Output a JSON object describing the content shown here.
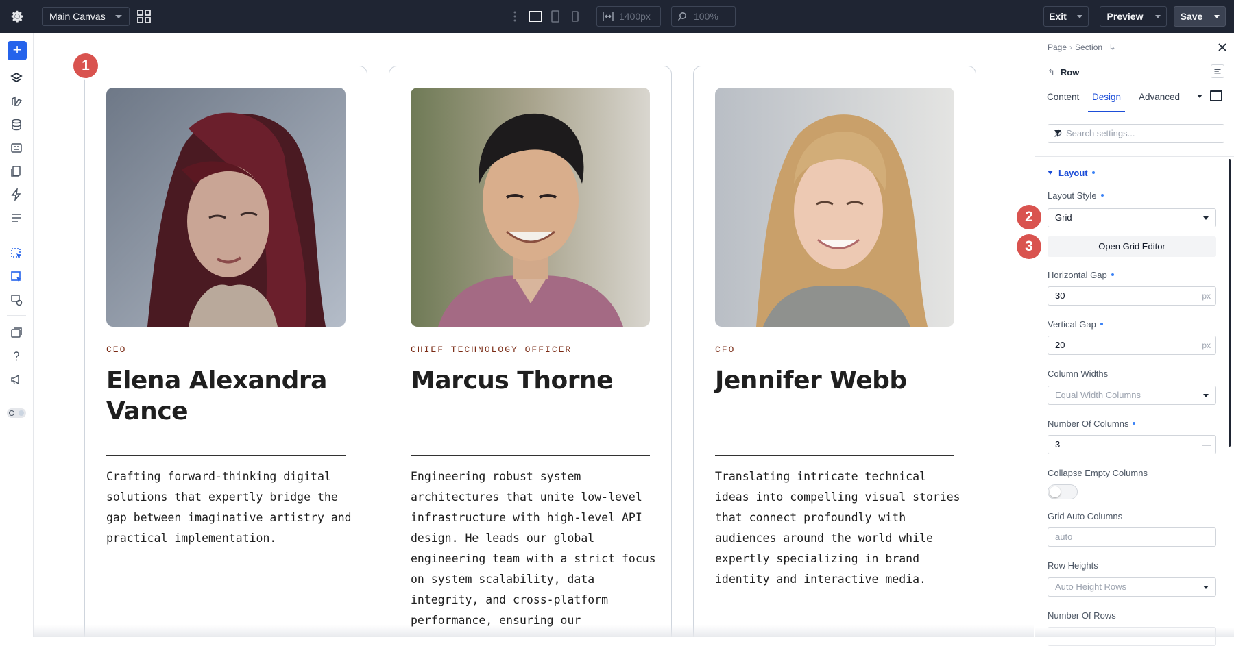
{
  "topbar": {
    "canvas_select": "Main Canvas",
    "width_value": "1400px",
    "zoom_value": "100%",
    "exit_label": "Exit",
    "preview_label": "Preview",
    "save_label": "Save"
  },
  "canvas": {
    "badges": [
      "1",
      "2",
      "3"
    ],
    "cards": [
      {
        "role": "CEO",
        "name": "Elena Alexandra Vance",
        "bio": "Crafting forward-thinking digital solutions that expertly bridge the gap between imaginative artistry and practical implementation."
      },
      {
        "role": "CHIEF TECHNOLOGY OFFICER",
        "name": "Marcus Thorne",
        "bio": "Engineering robust system architectures that unite low-level infrastructure with high-level API design. He leads our global engineering team with a strict focus on system scalability, data integrity, and cross-platform performance, ensuring our"
      },
      {
        "role": "CFO",
        "name": "Jennifer Webb",
        "bio": "Translating intricate technical ideas into compelling visual stories that connect profoundly with audiences around the world while expertly specializing in brand identity and interactive media."
      }
    ]
  },
  "panel": {
    "breadcrumb": [
      "Page",
      "Section"
    ],
    "element_title": "Row",
    "tabs": [
      "Content",
      "Design",
      "Advanced"
    ],
    "active_tab": "Design",
    "search_placeholder": "Search settings...",
    "section_title": "Layout",
    "fields": {
      "layout_style_label": "Layout Style",
      "layout_style_value": "Grid",
      "grid_editor_label": "Open Grid Editor",
      "horizontal_gap_label": "Horizontal Gap",
      "horizontal_gap_value": "30",
      "vertical_gap_label": "Vertical Gap",
      "vertical_gap_value": "20",
      "unit": "px",
      "column_widths_label": "Column Widths",
      "column_widths_value": "Equal Width Columns",
      "num_columns_label": "Number Of Columns",
      "num_columns_value": "3",
      "num_columns_suffix": "—",
      "collapse_label": "Collapse Empty Columns",
      "collapse_on": false,
      "grid_auto_columns_label": "Grid Auto Columns",
      "grid_auto_columns_placeholder": "auto",
      "row_heights_label": "Row Heights",
      "row_heights_value": "Auto Height Rows",
      "num_rows_label": "Number Of Rows"
    }
  },
  "colors": {
    "topbar_bg": "#1f2533",
    "accent_blue": "#2563eb",
    "badge_red": "#d9534f",
    "role_text": "#7a2a14"
  }
}
